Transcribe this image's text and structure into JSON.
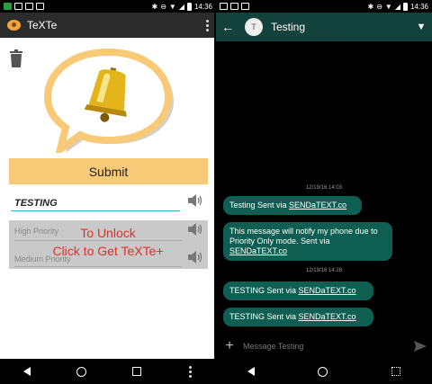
{
  "left": {
    "status": {
      "time": "14:36"
    },
    "app": {
      "title": "TeXTe"
    },
    "submit_label": "Submit",
    "message_value": "TESTING",
    "options": {
      "high_label": "High Priority",
      "medium_label": "Medium Priority"
    },
    "unlock": {
      "line1": "To Unlock",
      "line2": "Click to Get TeXTe+"
    }
  },
  "right": {
    "status": {
      "time": "14:36"
    },
    "header": {
      "avatar_letter": "T",
      "title": "Testing"
    },
    "messages": [
      {
        "date": "12/19/16 14:03"
      },
      {
        "text": "Testing Sent via ",
        "link": "SENDaTEXT.co"
      },
      {
        "text": "This message will notify my phone due to Priority Only mode. Sent via ",
        "link": "SENDaTEXT.co"
      },
      {
        "date": "12/19/16 14:28"
      },
      {
        "text": "TESTING Sent via ",
        "link": "SENDaTEXT.co"
      },
      {
        "text": "TESTING Sent via ",
        "link": "SENDaTEXT.co"
      }
    ],
    "compose": {
      "placeholder": "Message Testing"
    }
  },
  "colors": {
    "accent": "#f8c977",
    "unlock_text": "#e0302b",
    "bubble": "#0f5e52",
    "header": "#12423b",
    "field_underline": "#3ab3c9"
  }
}
